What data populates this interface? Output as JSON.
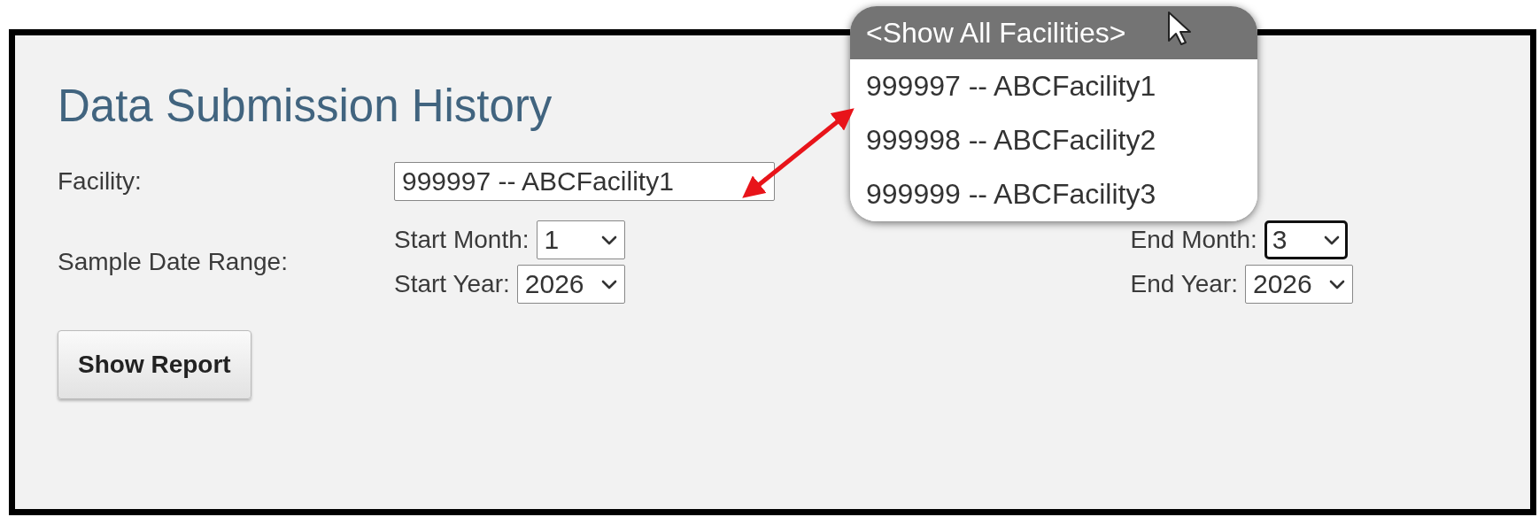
{
  "title": "Data Submission History",
  "facility": {
    "label": "Facility:",
    "value": "999997 -- ABCFacility1"
  },
  "date_range": {
    "label": "Sample Date Range:",
    "start_month": {
      "label": "Start Month:",
      "value": "1",
      "focused": false
    },
    "start_year": {
      "label": "Start Year:",
      "value": "2026",
      "focused": false
    },
    "end_month": {
      "label": "End Month:",
      "value": "3",
      "focused": true
    },
    "end_year": {
      "label": "End Year:",
      "value": "2026",
      "focused": false
    }
  },
  "button": "Show Report",
  "dropdown": {
    "options": [
      {
        "label": "<Show All Facilities>",
        "highlighted": true
      },
      {
        "label": "999997 -- ABCFacility1",
        "highlighted": false
      },
      {
        "label": "999998 -- ABCFacility2",
        "highlighted": false
      },
      {
        "label": "999999 -- ABCFacility3",
        "highlighted": false
      }
    ]
  }
}
